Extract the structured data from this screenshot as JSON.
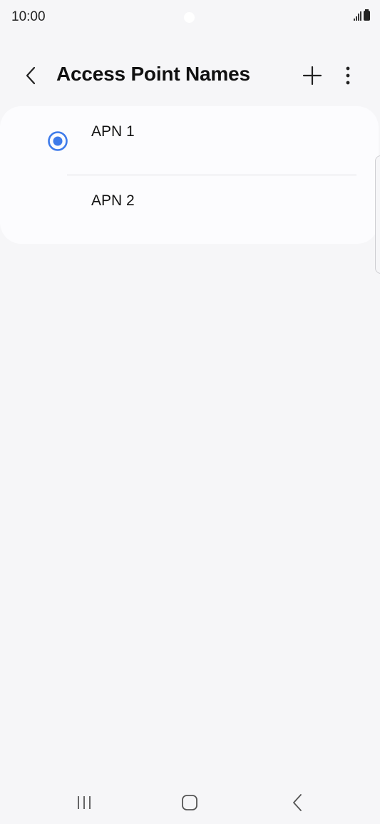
{
  "status_bar": {
    "time": "10:00",
    "icons": [
      "camera-dot",
      "signal-icon",
      "battery-icon"
    ]
  },
  "app_bar": {
    "title": "Access Point Names",
    "back_icon": "chevron-left-icon",
    "add_icon": "plus-icon",
    "more_icon": "more-vertical-icon"
  },
  "apn_list": {
    "items": [
      {
        "label": "APN 1",
        "selected": true
      },
      {
        "label": "APN 2",
        "selected": false
      }
    ]
  },
  "nav_bar": {
    "icons": [
      "recents-icon",
      "home-icon",
      "back-icon"
    ]
  },
  "colors": {
    "accent": "#3e7bea",
    "background": "#f6f6f8",
    "card": "#fcfcfe"
  }
}
